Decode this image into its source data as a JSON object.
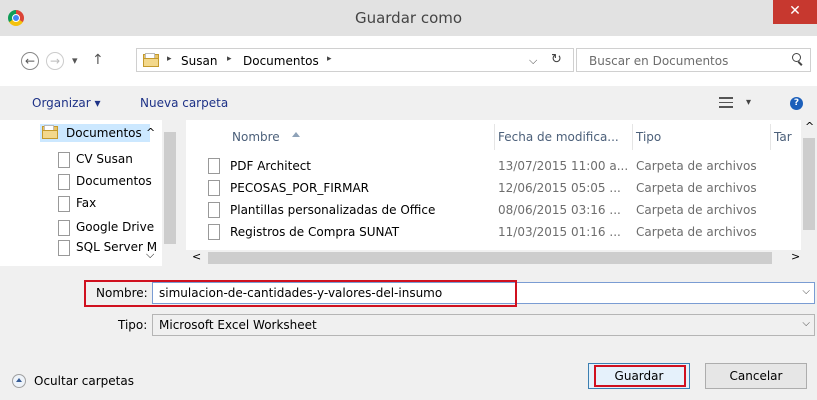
{
  "window": {
    "title": "Guardar como",
    "close_glyph": "✕",
    "icon": "chrome-icon"
  },
  "nav": {
    "back_glyph": "←",
    "forward_glyph": "→",
    "recent_glyph": "▾",
    "up_glyph": "↑",
    "breadcrumb": [
      "Susan",
      "Documentos"
    ],
    "crumb_sep": "▸",
    "dropdown_glyph": "⌵",
    "refresh_glyph": "↻",
    "search_placeholder": "Buscar en Documentos"
  },
  "toolbar": {
    "organize": "Organizar ▾",
    "new_folder": "Nueva carpeta",
    "view_dropdown": "▾",
    "help": "?"
  },
  "sidebar": {
    "items": [
      {
        "label": "Documentos",
        "expand": "^",
        "selected": true
      },
      {
        "label": "CV Susan"
      },
      {
        "label": "Documentos"
      },
      {
        "label": "Fax"
      },
      {
        "label": "Google Drive"
      },
      {
        "label": "SQL Server M",
        "expand": "⌵"
      }
    ]
  },
  "files": {
    "columns": {
      "name": "Nombre",
      "date": "Fecha de modifica...",
      "type": "Tipo",
      "size": "Tar"
    },
    "rows": [
      {
        "name": "PDF Architect",
        "date": "13/07/2015 11:00 a...",
        "type": "Carpeta de archivos"
      },
      {
        "name": "PECOSAS_POR_FIRMAR",
        "date": "12/06/2015 05:05 ...",
        "type": "Carpeta de archivos"
      },
      {
        "name": "Plantillas personalizadas de Office",
        "date": "08/06/2015 03:16 ...",
        "type": "Carpeta de archivos"
      },
      {
        "name": "Registros de Compra SUNAT",
        "date": "11/03/2015 01:16 ...",
        "type": "Carpeta de archivos"
      }
    ],
    "scroll_left": "<",
    "scroll_right": ">",
    "scroll_up": "^"
  },
  "form": {
    "filename_label": "Nombre:",
    "filename_value": "simulacion-de-cantidades-y-valores-del-insumo",
    "type_label": "Tipo:",
    "type_value": "Microsoft Excel Worksheet",
    "dropdown_glyph": "⌵"
  },
  "footer": {
    "hide_folders": "Ocultar carpetas",
    "save": "Guardar",
    "cancel": "Cancelar"
  },
  "colors": {
    "highlight": "#d0101f",
    "link": "#1e3287",
    "selection": "#cce8ff",
    "close": "#c7382f"
  }
}
